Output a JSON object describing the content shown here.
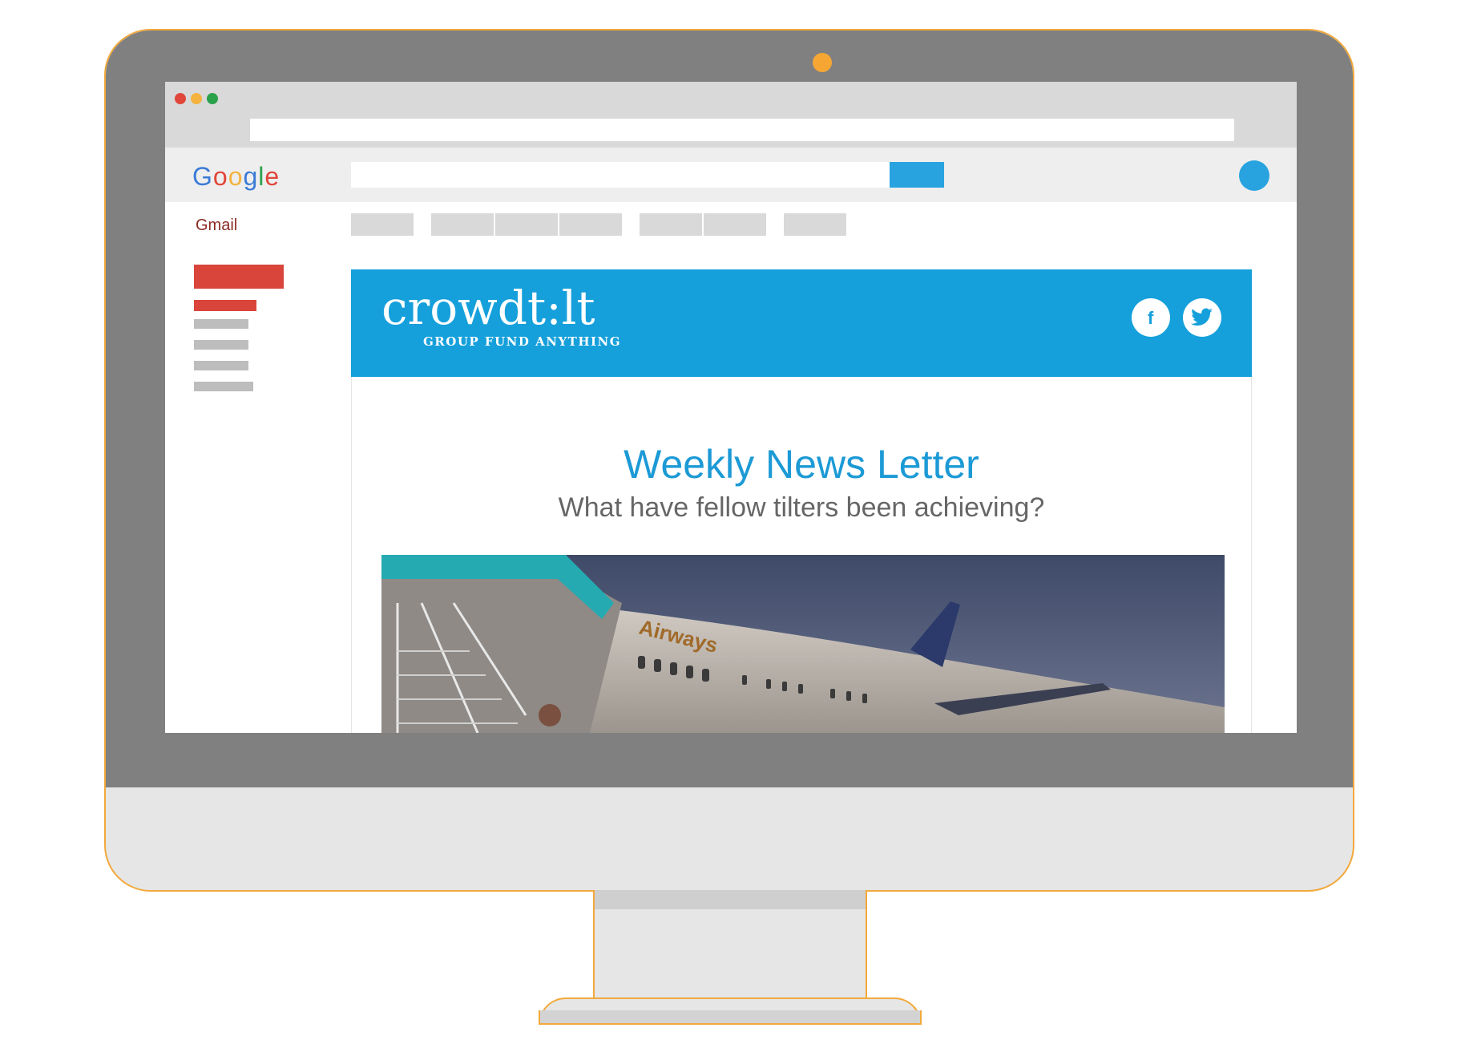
{
  "browser": {
    "traffic_lights": [
      "#e0463a",
      "#f4b33f",
      "#2aa24b"
    ]
  },
  "google": {
    "logo_letters": [
      {
        "char": "G",
        "color": "#3b7bd6"
      },
      {
        "char": "o",
        "color": "#e0463a"
      },
      {
        "char": "o",
        "color": "#f4b33f"
      },
      {
        "char": "g",
        "color": "#3b7bd6"
      },
      {
        "char": "l",
        "color": "#2aa24b"
      },
      {
        "char": "e",
        "color": "#e0463a"
      }
    ],
    "search_button_color": "#29a3df"
  },
  "gmail": {
    "label": "Gmail"
  },
  "email": {
    "brand": {
      "name": "crowdt:lt",
      "tagline": "GROUP FUND ANYTHING",
      "color": "#15a0db"
    },
    "social_icons": [
      "facebook-icon",
      "twitter-icon"
    ],
    "title": "Weekly News Letter",
    "subtitle": "What have fellow tilters been achieving?",
    "hero": {
      "airline_text": "Airways"
    }
  },
  "colors": {
    "accent_orange": "#f2a93b",
    "bezel": "#808080",
    "gmail_red": "#d9453b"
  }
}
